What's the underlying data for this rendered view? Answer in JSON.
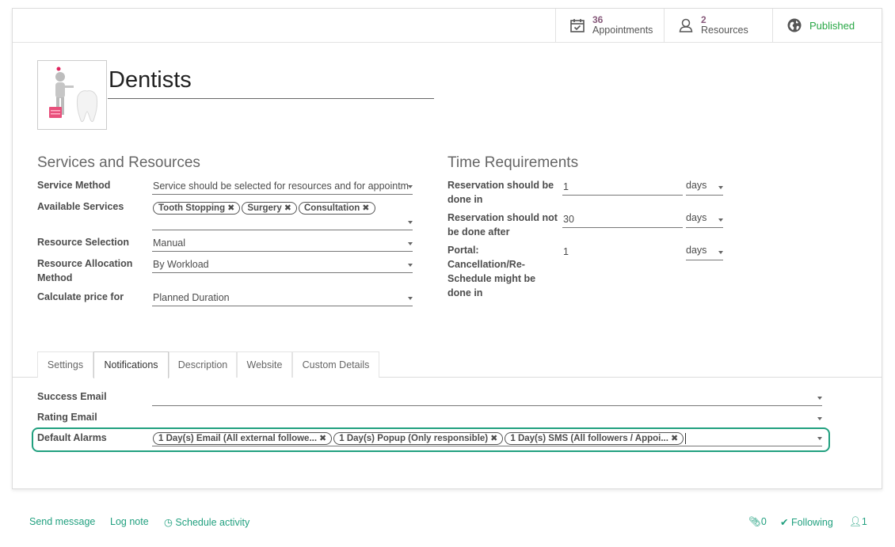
{
  "stats": {
    "appointments_count": "36",
    "appointments_label": "Appointments",
    "resources_count": "2",
    "resources_label": "Resources",
    "published_label": "Published"
  },
  "record": {
    "title": "Dentists"
  },
  "services": {
    "group_title": "Services and Resources",
    "service_method_label": "Service Method",
    "service_method_value": "Service should be selected for resources and for appointm",
    "available_services_label": "Available Services",
    "available_services_tags": [
      "Tooth Stopping",
      "Surgery",
      "Consultation"
    ],
    "resource_selection_label": "Resource Selection",
    "resource_selection_value": "Manual",
    "resource_allocation_label": "Resource Allocation Method",
    "resource_allocation_value": "By Workload",
    "calc_price_label": "Calculate price for",
    "calc_price_value": "Planned Duration"
  },
  "time": {
    "group_title": "Time Requirements",
    "reservation_done_in_label": "Reservation should be done in",
    "reservation_done_in_value": "1",
    "reservation_not_after_label": "Reservation should not be done after",
    "reservation_not_after_value": "30",
    "portal_label": "Portal: Cancellation/Re-Schedule might be done in",
    "portal_value": "1",
    "unit": "days"
  },
  "tabs": [
    "Settings",
    "Notifications",
    "Description",
    "Website",
    "Custom Details"
  ],
  "notifications": {
    "success_email_label": "Success Email",
    "rating_email_label": "Rating Email",
    "default_alarms_label": "Default Alarms",
    "default_alarms_tags": [
      "1 Day(s) Email (All external followe...",
      "1 Day(s) Popup (Only responsible)",
      "1 Day(s) SMS (All followers / Appoi..."
    ]
  },
  "chatter": {
    "send_message": "Send message",
    "log_note": "Log note",
    "schedule_activity": "Schedule activity",
    "attachments_count": "0",
    "following_label": "Following",
    "followers_count": "1"
  },
  "colors": {
    "accent": "#21a07f",
    "stat_number": "#875a7b",
    "published": "#28a745"
  }
}
